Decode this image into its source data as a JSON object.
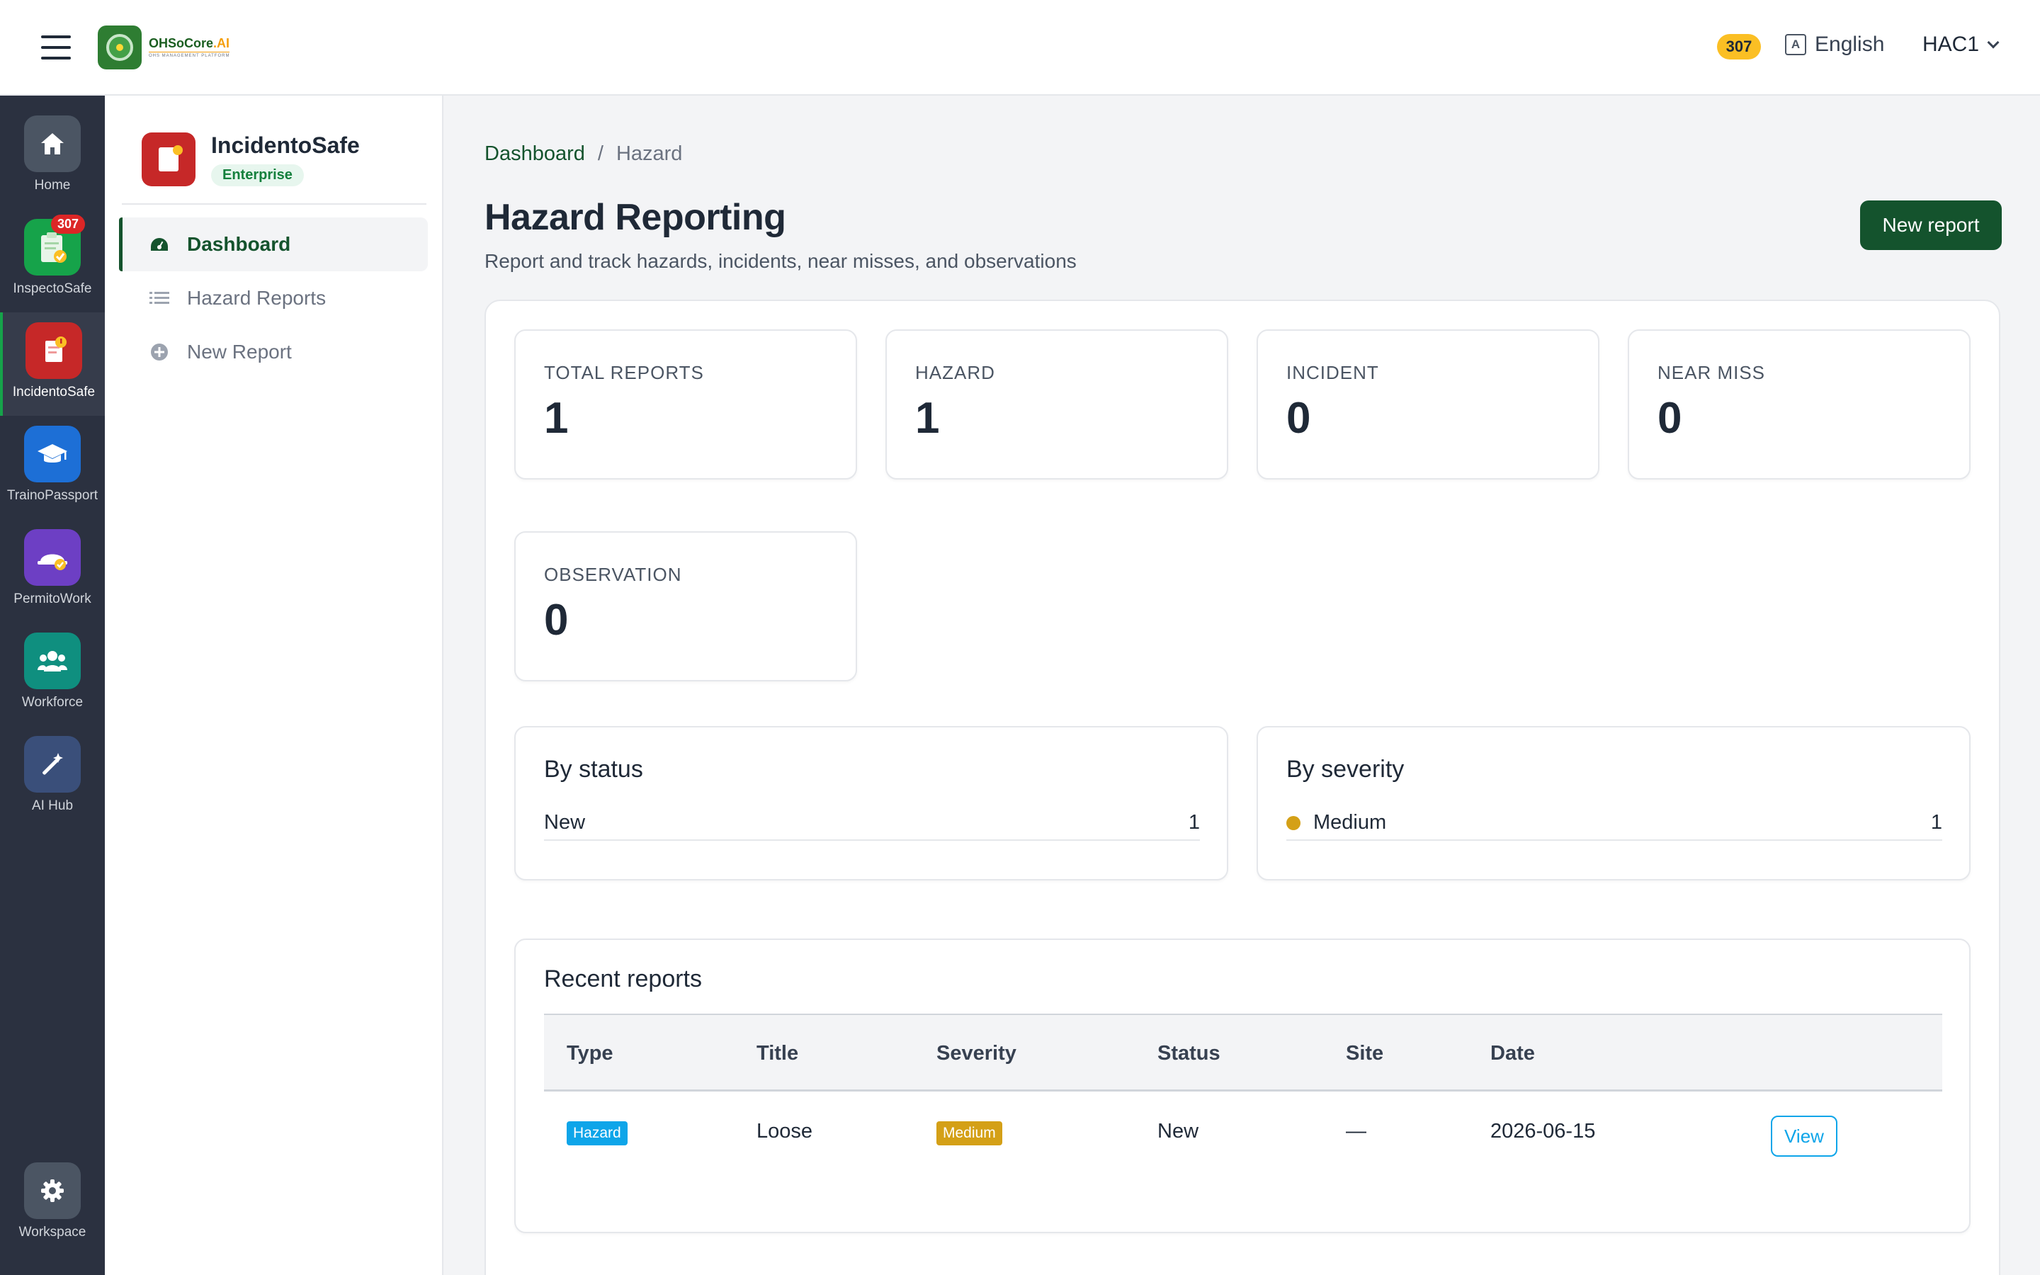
{
  "topbar": {
    "logo_text": "OHSoCore",
    "logo_suffix": ".AI",
    "logo_tagline": "OHS MANAGEMENT PLATFORM",
    "notification_count": "307",
    "language": "English",
    "user": "HAC1"
  },
  "rail": {
    "items": [
      {
        "label": "Home",
        "icon": "home-icon",
        "color": "#4b5563"
      },
      {
        "label": "InspectoSafe",
        "icon": "clipboard-check-icon",
        "color": "#16a34a",
        "badge": "307"
      },
      {
        "label": "IncidentoSafe",
        "icon": "incident-report-icon",
        "color": "#c62828"
      },
      {
        "label": "TrainoPassport",
        "icon": "graduation-cap-icon",
        "color": "#1d6fd6"
      },
      {
        "label": "PermitoWork",
        "icon": "hard-hat-icon",
        "color": "#6d3fc4"
      },
      {
        "label": "Workforce",
        "icon": "users-icon",
        "color": "#0f8f7f"
      },
      {
        "label": "AI Hub",
        "icon": "magic-wand-icon",
        "color": "#3a4f7a"
      },
      {
        "label": "Workspace",
        "icon": "gear-icon",
        "color": "#4b5563"
      }
    ]
  },
  "sidebar": {
    "app_name": "IncidentoSafe",
    "app_tier": "Enterprise",
    "nav": [
      {
        "label": "Dashboard",
        "icon": "dashboard-gauge-icon"
      },
      {
        "label": "Hazard Reports",
        "icon": "list-icon"
      },
      {
        "label": "New Report",
        "icon": "plus-circle-icon"
      }
    ]
  },
  "main": {
    "breadcrumb": {
      "root": "Dashboard",
      "separator": "/",
      "current": "Hazard"
    },
    "title": "Hazard Reporting",
    "subtitle": "Report and track hazards, incidents, near misses, and observations",
    "new_report_label": "New report",
    "stats": [
      {
        "label": "TOTAL REPORTS",
        "value": "1"
      },
      {
        "label": "HAZARD",
        "value": "1"
      },
      {
        "label": "INCIDENT",
        "value": "0"
      },
      {
        "label": "NEAR MISS",
        "value": "0"
      },
      {
        "label": "OBSERVATION",
        "value": "0"
      }
    ],
    "by_status": {
      "title": "By status",
      "rows": [
        {
          "label": "New",
          "count": "1"
        }
      ]
    },
    "by_severity": {
      "title": "By severity",
      "rows": [
        {
          "label": "Medium",
          "count": "1",
          "color": "#d4a017"
        }
      ]
    },
    "recent": {
      "title": "Recent reports",
      "columns": [
        "Type",
        "Title",
        "Severity",
        "Status",
        "Site",
        "Date"
      ],
      "rows": [
        {
          "type": "Hazard",
          "type_color": "#0ea5e9",
          "title": "Loose",
          "severity": "Medium",
          "severity_color": "#d4a017",
          "status": "New",
          "site": "—",
          "date": "2026-06-15",
          "action": "View"
        }
      ]
    }
  }
}
